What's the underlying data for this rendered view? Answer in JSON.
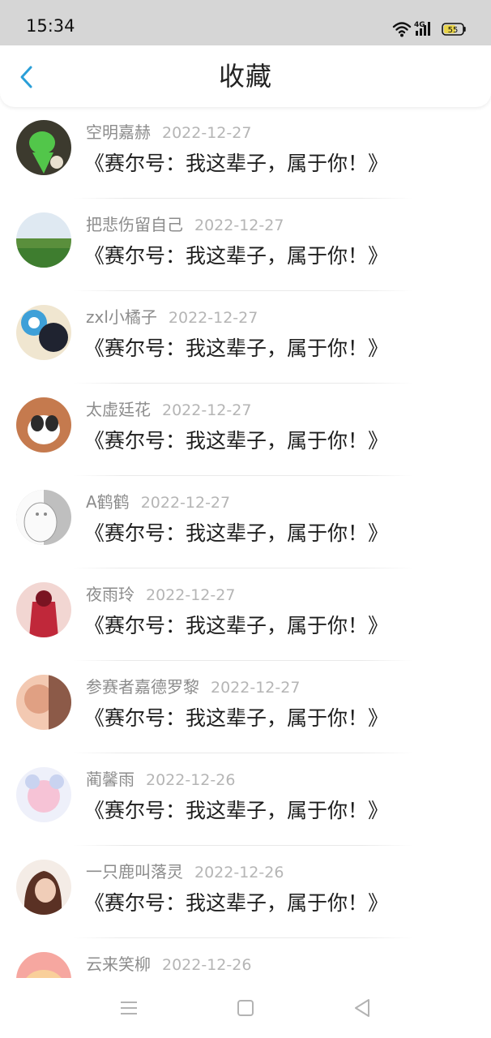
{
  "status_bar": {
    "time": "15:34",
    "network": "4G",
    "battery": "55"
  },
  "header": {
    "back_icon": "chevron-left-icon",
    "title": "收藏"
  },
  "favorites": [
    {
      "user": "空明嘉赫",
      "date": "2022-12-27",
      "title": "《赛尔号：我这辈子，属于你！》",
      "avatar_colors": [
        "#3c3a2e",
        "#52c64a",
        "#e8e0d0"
      ]
    },
    {
      "user": "把悲伤留自己",
      "date": "2022-12-27",
      "title": "《赛尔号：我这辈子，属于你！》",
      "avatar_colors": [
        "#dfe9f2",
        "#3e7d2f",
        "#5a8f3c"
      ]
    },
    {
      "user": "zxl小橘子",
      "date": "2022-12-27",
      "title": "《赛尔号：我这辈子，属于你！》",
      "avatar_colors": [
        "#1f2330",
        "#3ea0d8",
        "#f0e6d0"
      ]
    },
    {
      "user": "太虚廷花",
      "date": "2022-12-27",
      "title": "《赛尔号：我这辈子，属于你！》",
      "avatar_colors": [
        "#c57a4e",
        "#ffffff",
        "#2b2b2b"
      ]
    },
    {
      "user": "A鹤鹤",
      "date": "2022-12-27",
      "title": "《赛尔号：我这辈子，属于你！》",
      "avatar_colors": [
        "#bfbfbf",
        "#fafafa",
        "#888888"
      ]
    },
    {
      "user": "夜雨玲",
      "date": "2022-12-27",
      "title": "《赛尔号：我这辈子，属于你！》",
      "avatar_colors": [
        "#f2d6d2",
        "#c0283a",
        "#7a1422"
      ]
    },
    {
      "user": "参赛者嘉德罗黎",
      "date": "2022-12-27",
      "title": "《赛尔号：我这辈子，属于你！》",
      "avatar_colors": [
        "#f3c9b2",
        "#8c5a48",
        "#e0a083"
      ]
    },
    {
      "user": "蔺馨雨",
      "date": "2022-12-26",
      "title": "《赛尔号：我这辈子，属于你！》",
      "avatar_colors": [
        "#eef0fa",
        "#f6c3d6",
        "#c9d3f0"
      ]
    },
    {
      "user": "一只鹿叫落灵",
      "date": "2022-12-26",
      "title": "《赛尔号：我这辈子，属于你！》",
      "avatar_colors": [
        "#f4ece6",
        "#5a3124",
        "#f0cdb8"
      ]
    },
    {
      "user": "云来笑柳",
      "date": "2022-12-26",
      "title": "",
      "avatar_colors": [
        "#f6a7a0",
        "#f9cf9a",
        "#ffffff"
      ]
    }
  ],
  "nav_bar": {
    "menu_icon": "menu-icon",
    "home_icon": "square-home-icon",
    "back_icon": "triangle-back-icon"
  }
}
